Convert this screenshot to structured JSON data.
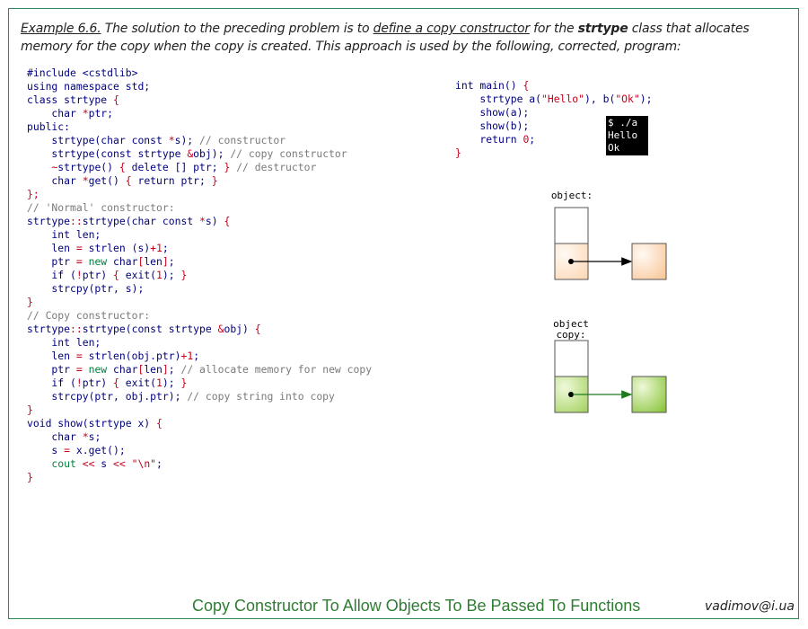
{
  "intro": {
    "example": "Example 6.6.",
    "t1": " The solution to the preceding problem is to ",
    "link": "define a copy constructor",
    "t2": " for the ",
    "bold": "strtype",
    "t3": " class that allocates memory for the copy when the copy is created. This approach is used by the following, corrected, program:"
  },
  "left_code": [
    [
      [
        "#include ",
        "k"
      ],
      [
        "<cstdlib>",
        "k"
      ]
    ],
    [
      [
        "using namespace std;",
        "k"
      ]
    ],
    [
      [
        "class strtype ",
        "k"
      ],
      [
        "{",
        "r"
      ]
    ],
    [
      [
        "    char ",
        "k"
      ],
      [
        "*",
        "r"
      ],
      [
        "ptr;",
        "k"
      ]
    ],
    [
      [
        "public:",
        "k"
      ]
    ],
    [
      [
        "    strtype(char const ",
        "k"
      ],
      [
        "*",
        "r"
      ],
      [
        "s); ",
        "k"
      ],
      [
        "// constructor",
        "c"
      ]
    ],
    [
      [
        "    strtype(const strtype ",
        "k"
      ],
      [
        "&",
        "r"
      ],
      [
        "obj); ",
        "k"
      ],
      [
        "// copy constructor",
        "c"
      ]
    ],
    [
      [
        "    ",
        "k"
      ],
      [
        "~",
        "r"
      ],
      [
        "strtype() ",
        "k"
      ],
      [
        "{",
        "r"
      ],
      [
        " delete [] ptr; ",
        "k"
      ],
      [
        "}",
        "r"
      ],
      [
        " ",
        "k"
      ],
      [
        "// destructor",
        "c"
      ]
    ],
    [
      [
        "    char ",
        "k"
      ],
      [
        "*",
        "r"
      ],
      [
        "get() ",
        "k"
      ],
      [
        "{",
        "r"
      ],
      [
        " return ptr; ",
        "k"
      ],
      [
        "}",
        "r"
      ]
    ],
    [
      [
        "};",
        "r"
      ]
    ],
    [
      [
        "// 'Normal' constructor:",
        "c"
      ]
    ],
    [
      [
        "strtype",
        "k"
      ],
      [
        "::",
        "r"
      ],
      [
        "strtype(char const ",
        "k"
      ],
      [
        "*",
        "r"
      ],
      [
        "s) ",
        "k"
      ],
      [
        "{",
        "r"
      ]
    ],
    [
      [
        "    int len;",
        "k"
      ]
    ],
    [
      [
        "    len ",
        "k"
      ],
      [
        "=",
        "r"
      ],
      [
        " strlen (s)",
        "k"
      ],
      [
        "+1",
        "r"
      ],
      [
        ";",
        "k"
      ]
    ],
    [
      [
        "    ptr ",
        "k"
      ],
      [
        "=",
        "r"
      ],
      [
        " ",
        "k"
      ],
      [
        "new",
        "g"
      ],
      [
        " char",
        "k"
      ],
      [
        "[",
        "r"
      ],
      [
        "len",
        "k"
      ],
      [
        "]",
        "r"
      ],
      [
        ";",
        "k"
      ]
    ],
    [
      [
        "    if (",
        "k"
      ],
      [
        "!",
        "r"
      ],
      [
        "ptr) ",
        "k"
      ],
      [
        "{",
        "r"
      ],
      [
        " exit(",
        "k"
      ],
      [
        "1",
        "r"
      ],
      [
        "); ",
        "k"
      ],
      [
        "}",
        "r"
      ]
    ],
    [
      [
        "    strcpy(ptr, s);",
        "k"
      ]
    ],
    [
      [
        "}",
        "r"
      ]
    ],
    [
      [
        "// Copy constructor:",
        "c"
      ]
    ],
    [
      [
        "strtype",
        "k"
      ],
      [
        "::",
        "r"
      ],
      [
        "strtype(const strtype ",
        "k"
      ],
      [
        "&",
        "r"
      ],
      [
        "obj) ",
        "k"
      ],
      [
        "{",
        "r"
      ]
    ],
    [
      [
        "    int len;",
        "k"
      ]
    ],
    [
      [
        "    len ",
        "k"
      ],
      [
        "=",
        "r"
      ],
      [
        " strlen(obj.ptr)",
        "k"
      ],
      [
        "+1",
        "r"
      ],
      [
        ";",
        "k"
      ]
    ],
    [
      [
        "    ptr ",
        "k"
      ],
      [
        "=",
        "r"
      ],
      [
        " ",
        "k"
      ],
      [
        "new",
        "g"
      ],
      [
        " char",
        "k"
      ],
      [
        "[",
        "r"
      ],
      [
        "len",
        "k"
      ],
      [
        "]",
        "r"
      ],
      [
        "; ",
        "k"
      ],
      [
        "// allocate memory for new copy",
        "c"
      ]
    ],
    [
      [
        "    if (",
        "k"
      ],
      [
        "!",
        "r"
      ],
      [
        "ptr) ",
        "k"
      ],
      [
        "{",
        "r"
      ],
      [
        " exit(",
        "k"
      ],
      [
        "1",
        "r"
      ],
      [
        "); ",
        "k"
      ],
      [
        "}",
        "r"
      ]
    ],
    [
      [
        "    strcpy(ptr, obj.ptr); ",
        "k"
      ],
      [
        "// copy string into copy",
        "c"
      ]
    ],
    [
      [
        "}",
        "r"
      ]
    ],
    [
      [
        "void show(strtype x) ",
        "k"
      ],
      [
        "{",
        "r"
      ]
    ],
    [
      [
        "    char ",
        "k"
      ],
      [
        "*",
        "r"
      ],
      [
        "s;",
        "k"
      ]
    ],
    [
      [
        "    s ",
        "k"
      ],
      [
        "=",
        "r"
      ],
      [
        " x.get();",
        "k"
      ]
    ],
    [
      [
        "    cout",
        "g"
      ],
      [
        " ",
        "k"
      ],
      [
        "<<",
        "r"
      ],
      [
        " s ",
        "k"
      ],
      [
        "<<",
        "r"
      ],
      [
        " ",
        "k"
      ],
      [
        "\"\\n\"",
        "r"
      ],
      [
        ";",
        "k"
      ]
    ],
    [
      [
        "}",
        "r"
      ]
    ]
  ],
  "right_code": [
    [
      [
        "int main() ",
        "k"
      ],
      [
        "{",
        "r"
      ]
    ],
    [
      [
        "    strtype a(",
        "k"
      ],
      [
        "\"Hello\"",
        "r"
      ],
      [
        "), b(",
        "k"
      ],
      [
        "\"Ok\"",
        "r"
      ],
      [
        ");",
        "k"
      ]
    ],
    [
      [
        "    show(a);",
        "k"
      ]
    ],
    [
      [
        "    show(b);",
        "k"
      ]
    ],
    [
      [
        "    return ",
        "k"
      ],
      [
        "0",
        "r"
      ],
      [
        ";",
        "k"
      ]
    ],
    [
      [
        "}",
        "r"
      ]
    ]
  ],
  "terminal": {
    "lines": [
      "$ ./a",
      "Hello",
      "Ok"
    ]
  },
  "diagram": {
    "label_object": "object:",
    "label_copy_line1": "object",
    "label_copy_line2": "copy:",
    "colors": {
      "orange_light": "#fff3e8",
      "orange_mid": "#f9c89b",
      "green_light": "#e8f5c8",
      "green_mid": "#8cc63f",
      "arrow_green": "#1e7a1e"
    }
  },
  "footer": {
    "title": "Copy Constructor To Allow Objects To Be Passed To Functions",
    "email": "vadimov@i.ua"
  }
}
